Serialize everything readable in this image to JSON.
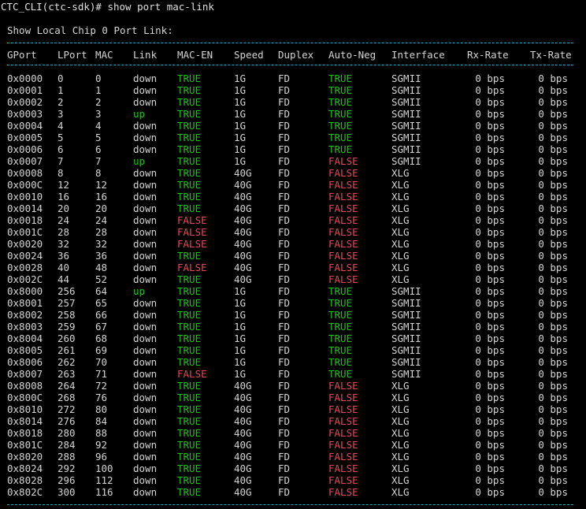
{
  "terminal": {
    "prompt": "CTC_CLI(ctc-sdk)# show port mac-link",
    "heading": "Show Local Chip 0 Port Link:",
    "columns": [
      "GPort",
      "LPort",
      "MAC",
      "Link",
      "MAC-EN",
      "Speed",
      "Duplex",
      "Auto-Neg",
      "Interface",
      "Rx-Rate",
      "Tx-Rate"
    ],
    "colors": {
      "true": "#16c60c",
      "false": "#e74856",
      "up": "#16c60c",
      "default": "#d4d4d4",
      "dash": "#00b7c3"
    },
    "rows": [
      [
        "0x0000",
        "0",
        "0",
        "down",
        "TRUE",
        "1G",
        "FD",
        "TRUE",
        "SGMII",
        "0 bps",
        "0 bps"
      ],
      [
        "0x0001",
        "1",
        "1",
        "down",
        "TRUE",
        "1G",
        "FD",
        "TRUE",
        "SGMII",
        "0 bps",
        "0 bps"
      ],
      [
        "0x0002",
        "2",
        "2",
        "down",
        "TRUE",
        "1G",
        "FD",
        "TRUE",
        "SGMII",
        "0 bps",
        "0 bps"
      ],
      [
        "0x0003",
        "3",
        "3",
        "up",
        "TRUE",
        "1G",
        "FD",
        "TRUE",
        "SGMII",
        "0 bps",
        "0 bps"
      ],
      [
        "0x0004",
        "4",
        "4",
        "down",
        "TRUE",
        "1G",
        "FD",
        "TRUE",
        "SGMII",
        "0 bps",
        "0 bps"
      ],
      [
        "0x0005",
        "5",
        "5",
        "down",
        "TRUE",
        "1G",
        "FD",
        "TRUE",
        "SGMII",
        "0 bps",
        "0 bps"
      ],
      [
        "0x0006",
        "6",
        "6",
        "down",
        "TRUE",
        "1G",
        "FD",
        "TRUE",
        "SGMII",
        "0 bps",
        "0 bps"
      ],
      [
        "0x0007",
        "7",
        "7",
        "up",
        "TRUE",
        "1G",
        "FD",
        "FALSE",
        "SGMII",
        "0 bps",
        "0 bps"
      ],
      [
        "0x0008",
        "8",
        "8",
        "down",
        "TRUE",
        "40G",
        "FD",
        "FALSE",
        "XLG",
        "0 bps",
        "0 bps"
      ],
      [
        "0x000C",
        "12",
        "12",
        "down",
        "TRUE",
        "40G",
        "FD",
        "FALSE",
        "XLG",
        "0 bps",
        "0 bps"
      ],
      [
        "0x0010",
        "16",
        "16",
        "down",
        "TRUE",
        "40G",
        "FD",
        "FALSE",
        "XLG",
        "0 bps",
        "0 bps"
      ],
      [
        "0x0014",
        "20",
        "20",
        "down",
        "TRUE",
        "40G",
        "FD",
        "FALSE",
        "XLG",
        "0 bps",
        "0 bps"
      ],
      [
        "0x0018",
        "24",
        "24",
        "down",
        "FALSE",
        "40G",
        "FD",
        "FALSE",
        "XLG",
        "0 bps",
        "0 bps"
      ],
      [
        "0x001C",
        "28",
        "28",
        "down",
        "FALSE",
        "40G",
        "FD",
        "FALSE",
        "XLG",
        "0 bps",
        "0 bps"
      ],
      [
        "0x0020",
        "32",
        "32",
        "down",
        "FALSE",
        "40G",
        "FD",
        "FALSE",
        "XLG",
        "0 bps",
        "0 bps"
      ],
      [
        "0x0024",
        "36",
        "36",
        "down",
        "TRUE",
        "40G",
        "FD",
        "FALSE",
        "XLG",
        "0 bps",
        "0 bps"
      ],
      [
        "0x0028",
        "40",
        "48",
        "down",
        "FALSE",
        "40G",
        "FD",
        "FALSE",
        "XLG",
        "0 bps",
        "0 bps"
      ],
      [
        "0x002C",
        "44",
        "52",
        "down",
        "TRUE",
        "40G",
        "FD",
        "FALSE",
        "XLG",
        "0 bps",
        "0 bps"
      ],
      [
        "0x8000",
        "256",
        "64",
        "up",
        "TRUE",
        "1G",
        "FD",
        "TRUE",
        "SGMII",
        "0 bps",
        "0 bps"
      ],
      [
        "0x8001",
        "257",
        "65",
        "down",
        "TRUE",
        "1G",
        "FD",
        "TRUE",
        "SGMII",
        "0 bps",
        "0 bps"
      ],
      [
        "0x8002",
        "258",
        "66",
        "down",
        "TRUE",
        "1G",
        "FD",
        "TRUE",
        "SGMII",
        "0 bps",
        "0 bps"
      ],
      [
        "0x8003",
        "259",
        "67",
        "down",
        "TRUE",
        "1G",
        "FD",
        "TRUE",
        "SGMII",
        "0 bps",
        "0 bps"
      ],
      [
        "0x8004",
        "260",
        "68",
        "down",
        "TRUE",
        "1G",
        "FD",
        "TRUE",
        "SGMII",
        "0 bps",
        "0 bps"
      ],
      [
        "0x8005",
        "261",
        "69",
        "down",
        "TRUE",
        "1G",
        "FD",
        "TRUE",
        "SGMII",
        "0 bps",
        "0 bps"
      ],
      [
        "0x8006",
        "262",
        "70",
        "down",
        "TRUE",
        "1G",
        "FD",
        "TRUE",
        "SGMII",
        "0 bps",
        "0 bps"
      ],
      [
        "0x8007",
        "263",
        "71",
        "down",
        "FALSE",
        "1G",
        "FD",
        "TRUE",
        "SGMII",
        "0 bps",
        "0 bps"
      ],
      [
        "0x8008",
        "264",
        "72",
        "down",
        "TRUE",
        "40G",
        "FD",
        "FALSE",
        "XLG",
        "0 bps",
        "0 bps"
      ],
      [
        "0x800C",
        "268",
        "76",
        "down",
        "TRUE",
        "40G",
        "FD",
        "FALSE",
        "XLG",
        "0 bps",
        "0 bps"
      ],
      [
        "0x8010",
        "272",
        "80",
        "down",
        "TRUE",
        "40G",
        "FD",
        "FALSE",
        "XLG",
        "0 bps",
        "0 bps"
      ],
      [
        "0x8014",
        "276",
        "84",
        "down",
        "TRUE",
        "40G",
        "FD",
        "FALSE",
        "XLG",
        "0 bps",
        "0 bps"
      ],
      [
        "0x8018",
        "280",
        "88",
        "down",
        "TRUE",
        "40G",
        "FD",
        "FALSE",
        "XLG",
        "0 bps",
        "0 bps"
      ],
      [
        "0x801C",
        "284",
        "92",
        "down",
        "TRUE",
        "40G",
        "FD",
        "FALSE",
        "XLG",
        "0 bps",
        "0 bps"
      ],
      [
        "0x8020",
        "288",
        "96",
        "down",
        "TRUE",
        "40G",
        "FD",
        "FALSE",
        "XLG",
        "0 bps",
        "0 bps"
      ],
      [
        "0x8024",
        "292",
        "100",
        "down",
        "TRUE",
        "40G",
        "FD",
        "FALSE",
        "XLG",
        "0 bps",
        "0 bps"
      ],
      [
        "0x8028",
        "296",
        "112",
        "down",
        "TRUE",
        "40G",
        "FD",
        "FALSE",
        "XLG",
        "0 bps",
        "0 bps"
      ],
      [
        "0x802C",
        "300",
        "116",
        "down",
        "TRUE",
        "40G",
        "FD",
        "FALSE",
        "XLG",
        "0 bps",
        "0 bps"
      ]
    ]
  }
}
